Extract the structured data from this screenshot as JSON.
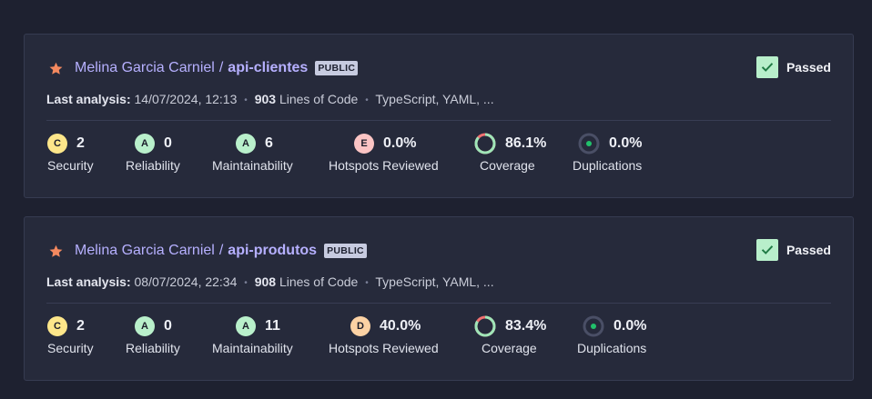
{
  "projects": [
    {
      "owner": "Melina Garcia Carniel",
      "separator": "/",
      "repo": "api-clientes",
      "visibility": "PUBLIC",
      "gate_status": "Passed",
      "analysis_label": "Last analysis:",
      "analysis_date": "14/07/2024, 12:13",
      "loc_value": "903",
      "loc_label": "Lines of Code",
      "languages": "TypeScript, YAML, ...",
      "security": {
        "grade": "C",
        "value": "2",
        "label": "Security"
      },
      "reliability": {
        "grade": "A",
        "value": "0",
        "label": "Reliability"
      },
      "maintainability": {
        "grade": "A",
        "value": "6",
        "label": "Maintainability"
      },
      "hotspots": {
        "grade": "E",
        "value": "0.0%",
        "label": "Hotspots Reviewed"
      },
      "coverage": {
        "value": "86.1%",
        "label": "Coverage",
        "fraction": 0.861
      },
      "duplications": {
        "value": "0.0%",
        "label": "Duplications"
      }
    },
    {
      "owner": "Melina Garcia Carniel",
      "separator": "/",
      "repo": "api-produtos",
      "visibility": "PUBLIC",
      "gate_status": "Passed",
      "analysis_label": "Last analysis:",
      "analysis_date": "08/07/2024, 22:34",
      "loc_value": "908",
      "loc_label": "Lines of Code",
      "languages": "TypeScript, YAML, ...",
      "security": {
        "grade": "C",
        "value": "2",
        "label": "Security"
      },
      "reliability": {
        "grade": "A",
        "value": "0",
        "label": "Reliability"
      },
      "maintainability": {
        "grade": "A",
        "value": "11",
        "label": "Maintainability"
      },
      "hotspots": {
        "grade": "D",
        "value": "40.0%",
        "label": "Hotspots Reviewed"
      },
      "coverage": {
        "value": "83.4%",
        "label": "Coverage",
        "fraction": 0.834
      },
      "duplications": {
        "value": "0.0%",
        "label": "Duplications"
      }
    }
  ],
  "colors": {
    "link": "#b6b0ff",
    "star": "#f4895f",
    "passed_bg": "#b8efcb",
    "coverage_good": "#9fe6b8",
    "coverage_bad": "#f07171",
    "duplication_dot": "#21c06b"
  },
  "icons": {
    "favorite": "star-icon",
    "gate": "check-icon",
    "coverage": "coverage-ring-icon",
    "duplications": "duplications-dot-icon"
  }
}
